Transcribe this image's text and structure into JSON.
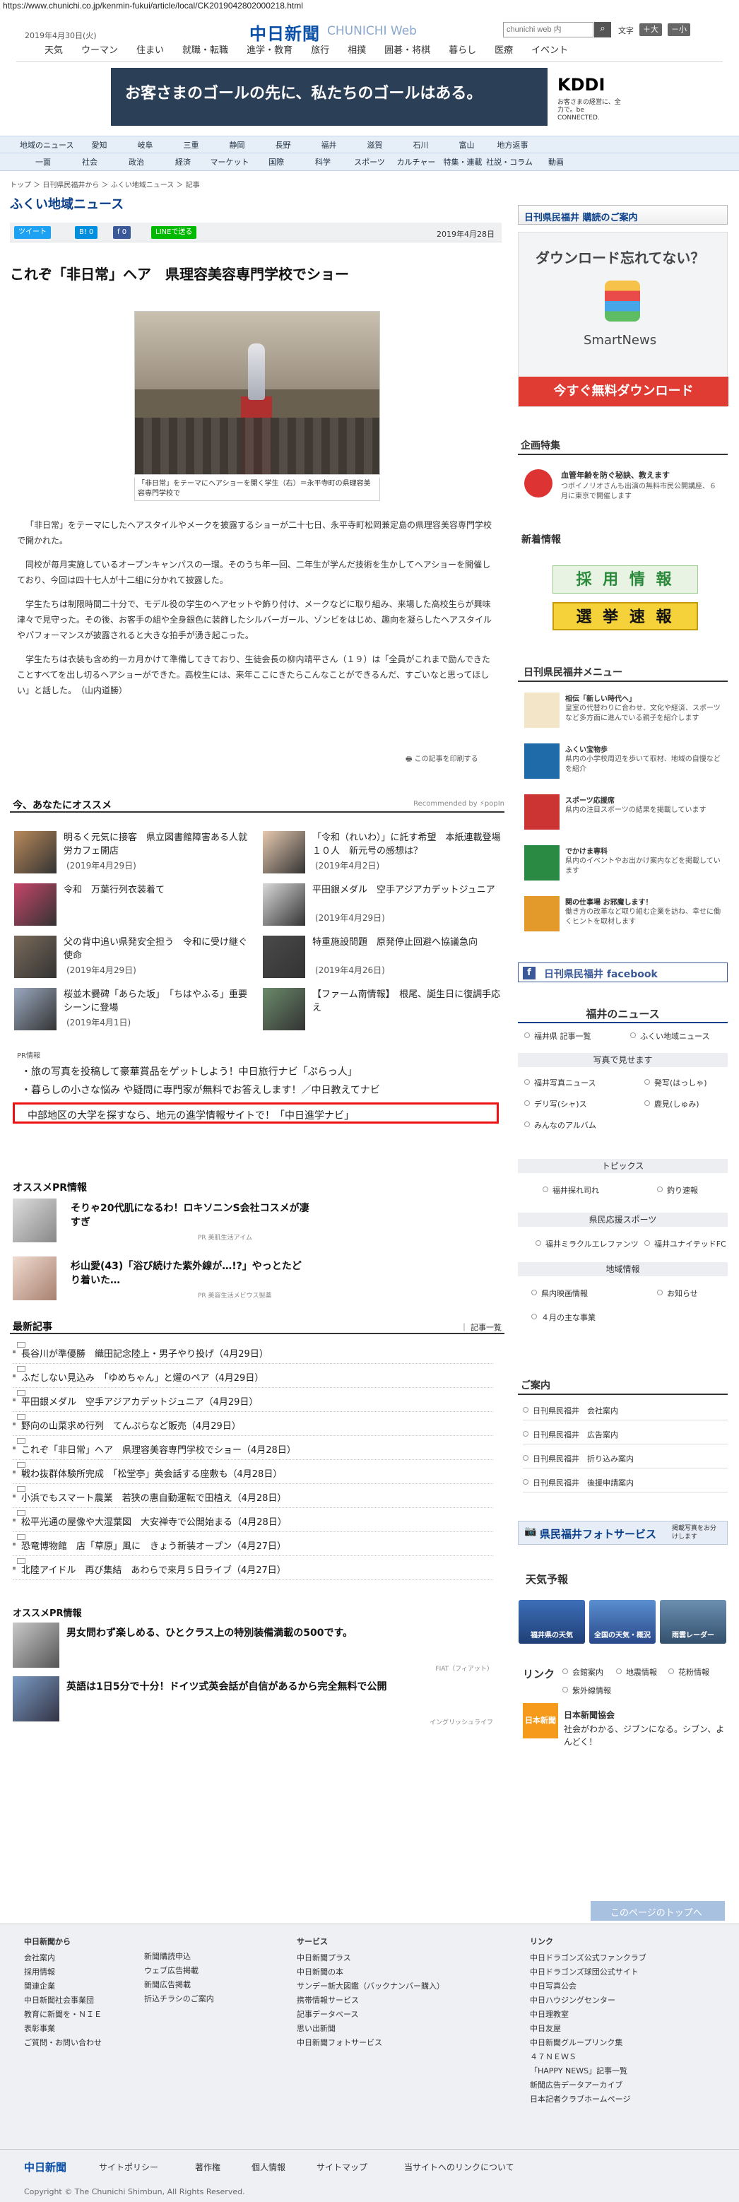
{
  "url": "https://www.chunichi.co.jp/kenmin-fukui/article/local/CK2019042802000218.html",
  "header": {
    "date": "2019年4月30日(火)",
    "logo": "中日新聞",
    "logo_sub": "CHUNICHI Web",
    "search_placeholder": "chunichi web 内",
    "moji_label": "文字",
    "font_large": "＋大",
    "font_small": "－小"
  },
  "top_nav": [
    "天気",
    "ウーマン",
    "住まい",
    "就職・転職",
    "進学・教育",
    "旅行",
    "相撲",
    "囲碁・将棋",
    "暮らし",
    "医療",
    "イベント"
  ],
  "ad": {
    "text": "お客さまのゴールの先に、私たちのゴールはある。",
    "brand": "KDDI",
    "brand_sub": "お客さまの経営に、全力で。be CONNECTED."
  },
  "region_nav_1": [
    "地域のニュース",
    "愛知",
    "岐阜",
    "三重",
    "静岡",
    "長野",
    "福井",
    "滋賀",
    "石川",
    "富山",
    "地方返事"
  ],
  "region_nav_2": [
    "一面",
    "社会",
    "政治",
    "経済",
    "マーケット",
    "国際",
    "科学",
    "スポーツ",
    "カルチャー",
    "特集・連載",
    "社説・コラム",
    "動画"
  ],
  "breadcrumb": "トップ ＞ 日刊県民福井から ＞ ふくい地域ニュース ＞ 記事",
  "page_title": "ふくい地域ニュース",
  "share": {
    "tweet": "ツイート",
    "hatena": "B! 0",
    "facebook": "f 0",
    "line": "LINEで送る"
  },
  "pub_date": "2019年4月28日",
  "article": {
    "headline": "これぞ「非日常」ヘア　県理容美容専門学校でショー",
    "caption": "「非日常」をテーマにヘアショーを開く学生（右）＝永平寺町の県理容美容専門学校で",
    "paragraphs": [
      "「非日常」をテーマにしたヘアスタイルやメークを披露するショーが二十七日、永平寺町松岡兼定島の県理容美容専門学校で開かれた。",
      "同校が毎月実施しているオープンキャンパスの一環。そのうち年一回、二年生が学んだ技術を生かしてヘアショーを開催しており、今回は四十七人が十二組に分かれて披露した。",
      "学生たちは制限時間二十分で、モデル役の学生のヘアセットや飾り付け、メークなどに取り組み、来場した高校生らが興味津々で見守った。その後、お客手の組や全身銀色に装飾したシルバーガール、ゾンビをはじめ、趣向を凝らしたヘアスタイルやパフォーマンスが披露されると大きな拍手が湧き起こった。",
      "学生たちは衣装も含め約一カ月かけて準備してきており、生徒会長の柳内靖平さん（１９）は「全員がこれまで励んできたことすべてを出し切るヘアショーができた。高校生には、来年ここにきたらこんなことができるんだ、すごいなと思ってほしい」と話した。　（山内道勝）"
    ],
    "print_link": "この記事を印刷する"
  },
  "recommend": {
    "title": "今、あなたにオススメ",
    "powered": "Recommended by ⚡popIn",
    "items": [
      {
        "title": "明るく元気に接客　県立図書館障害ある人就労カフェ開店",
        "date": "(2019年4月29日)"
      },
      {
        "title": "「令和（れいわ）」に託す希望　本紙連載登場１０人　新元号の感想は？",
        "date": "(2019年4月2日)"
      },
      {
        "title": "令和　万葉行列衣装着て",
        "date": ""
      },
      {
        "title": "平田銀メダル　空手アジアカデットジュニア",
        "date": "(2019年4月29日)"
      },
      {
        "title": "父の背中追い県発安全担う　令和に受け継ぐ使命",
        "date": "(2019年4月29日)"
      },
      {
        "title": "特重施設問題　原発停止回避へ協議急向",
        "date": "(2019年4月26日)"
      },
      {
        "title": "桜並木爨碑「あらた坂」　「ちはやふる」重要シーンに登場",
        "date": "(2019年4月1日)"
      },
      {
        "title": "【ファーム南情報】　根尾、誕生日に復調手応え",
        "date": ""
      }
    ]
  },
  "pr": {
    "label": "PR情報",
    "lines": [
      "旅の写真を投稿して豪華賞品をゲットしよう！中日旅行ナビ「ぷらっ人」",
      "暮らしの小さな悩み や疑問に専門家が無料でお答えします！／中日教えてナビ"
    ],
    "highlight": "中部地区の大学を探すなら、地元の進学情報サイトで！「中日進学ナビ」"
  },
  "osusume_pr": {
    "title": "オススメPR情報",
    "items": [
      {
        "title": "そりゃ20代肌になるわ！ロキソニンS会社コスメが凄すぎ",
        "source": "PR 美肌生活アイム"
      },
      {
        "title": "杉山愛(43)「浴び続けた紫外線が…!?」やっとたどり着いた…",
        "source": "PR 美容生活メビウス製薬"
      }
    ]
  },
  "latest": {
    "title": "最新記事",
    "more": "｜ 記事一覧",
    "items": [
      "長谷川が準優勝　織田記念陸上・男子やり投げ（4月29日）",
      "ふだしない見込み　「ゆめちゃん」と燿のペア（4月29日）",
      "平田銀メダル　空手アジアカデットジュニア（4月29日）",
      "野向の山菜求め行列　てんぷらなど販売（4月29日）",
      "これぞ「非日常」ヘア　県理容美容専門学校でショー（4月28日）",
      "戦わ抜群体験所完成　「松堂亭」英会話する座敷も（4月28日）",
      "小浜でもスマート農業　若狭の惠自動運転で田植え（4月28日）",
      "松平光通の屋像や大湿葉図　大安禅寺で公開始まる（4月28日）",
      "恐竜博物館　店「草原」風に　きょう新装オープン（4月27日）",
      "北陸アイドル　再び集結　あわらで来月５日ライブ（4月27日）"
    ]
  },
  "bottom_pr": {
    "title": "オススメPR情報",
    "items": [
      {
        "title": "男女問わず楽しめる、ひとクラス上の特別装備満載の500です。",
        "source": "FIAT（フィアット）"
      },
      {
        "title": "英語は1日5分で十分！ドイツ式英会話が自信があるから完全無料で公開",
        "source": "イングリッシュライフ"
      }
    ]
  },
  "sidebar": {
    "subscribe": "日刊県民福井 購読のご案内",
    "smartnews": {
      "title": "ダウンロード忘れてない？",
      "name": "SmartNews",
      "cta": "今すぐ無料ダウンロード"
    },
    "kikaku_title": "企画特集",
    "kikaku_item": {
      "title": "血管年齢を防ぐ秘訣、教えます",
      "desc": "つボイノリオさんも出演の無料市民公開講座、６月に東京で開催します"
    },
    "new_title": "新着情報",
    "banner1": "採 用 情 報",
    "banner2": "選 挙 速 報",
    "menu_title": "日刊県民福井メニュー",
    "menu": [
      {
        "title": "相伝「新しい時代へ」",
        "desc": "皇室の代替わりに合わせ、文化や経済、スポーツなど多方面に進んでいる親子を紹介します"
      },
      {
        "title": "ふくい宝物歩",
        "desc": "県内の小学校周辺を歩いて取材、地域の自慢などを紹介"
      },
      {
        "title": "スポーツ応援席",
        "desc": "県内の注目スポーツの結果を掲載しています"
      },
      {
        "title": "でかけま専科",
        "desc": "県内のイベントやお出かけ案内などを掲載しています"
      },
      {
        "title": "関の仕事場 お邪魔します！",
        "desc": "働き方の改革など取り組む企業を訪ね、幸せに働くヒントを取材します"
      }
    ],
    "facebook": "日刊県民福井 facebook",
    "fukui_news": "福井のニュース",
    "fn_links": [
      "福井県 記事一覧",
      "ふくい地域ニュース"
    ],
    "photo_head": "写真で見せます",
    "photo_links": [
      "福井写真ニュース",
      "発写(はっしゃ)",
      "デリ写(シャ)ス",
      "鹿見(しゅみ)",
      "みんなのアルバム"
    ],
    "topics_head": "トピックス",
    "topics_links": [
      "福井探れ司れ",
      "釣り速報"
    ],
    "sports_head": "県民応援スポーツ",
    "sports_links": [
      "福井ミラクルエレファンツ",
      "福井ユナイテッドFC"
    ],
    "local_head": "地域情報",
    "local_links": [
      "県内映画情報",
      "お知らせ",
      "４月の主な事業"
    ],
    "goannai_title": "ご案内",
    "goannai": [
      "日刊県民福井　会社案内",
      "日刊県民福井　広告案内",
      "日刊県民福井　折り込み案内",
      "日刊県民福井　後援申請案内"
    ],
    "photo_service": "県民福井フォトサービス",
    "photo_service_sub": "掲載写真をお分けします",
    "tenki_title": "天気予報",
    "tenki": [
      "福井県の天気",
      "全国の天気・概況",
      "雨雲レーダー"
    ],
    "link_title": "リンク",
    "link_items": [
      "会館案内",
      "地震情報",
      "花粉情報",
      "紫外線情報"
    ],
    "nikkai": {
      "badge": "日本新聞",
      "title": "日本新聞協会",
      "desc": "社会がわかる、ジブンになる。シブン、よんどく！"
    }
  },
  "pagetop": "このページのトップへ",
  "footer": {
    "col1_head": "中日新聞から",
    "col1": [
      "会社案内",
      "採用情報",
      "関連企業",
      "中日新聞社会事業団",
      "教育に新聞を・ＮＩＥ",
      "表彰事業",
      "ご質問・お問い合わせ"
    ],
    "col2": [
      "新聞購読申込",
      "ウェブ広告掲載",
      "新聞広告掲載",
      "折込チラシのご案内"
    ],
    "col3_head": "サービス",
    "col3": [
      "中日新聞プラス",
      "中日新聞の本",
      "サンデー新大図鑑（バックナンバー購入）",
      "携帯情報サービス",
      "記事データベース",
      "思い出新聞",
      "中日新聞フォトサービス"
    ],
    "col4_head": "リンク",
    "col4": [
      "中日ドラゴンズ公式ファンクラブ",
      "中日ドラゴンズ球団公式サイト",
      "中日写真公会",
      "中日ハウジングセンター",
      "中日理教室",
      "中日友屋",
      "中日新聞グループリンク集",
      "４７ＮＥＷＳ",
      "「HAPPY NEWS」記事一覧",
      "新聞広告データアーカイブ",
      "日本記者クラブホームページ"
    ],
    "bar": [
      "サイトポリシー",
      "著作権",
      "個人情報",
      "サイトマップ",
      "当サイトへのリンクについて"
    ],
    "copyright": "Copyright © The Chunichi Shimbun, All Rights Reserved."
  }
}
